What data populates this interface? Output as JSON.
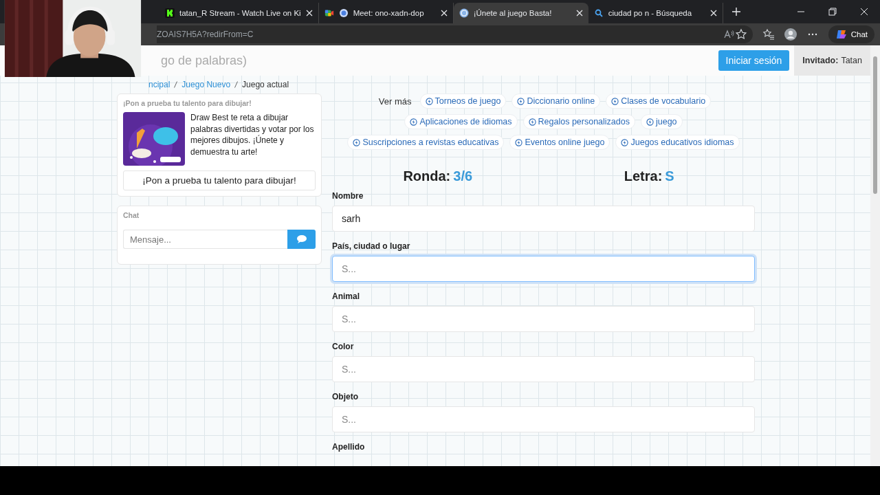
{
  "browser": {
    "tabs": [
      {
        "kind": "kick",
        "title": "tatan_R Stream - Watch Live on Ki",
        "selected": false
      },
      {
        "kind": "meet",
        "title": "Meet: ono-xadn-dop",
        "selected": false
      },
      {
        "kind": "game",
        "title": "¡Únete al juego Basta!",
        "selected": true
      },
      {
        "kind": "search",
        "title": "ciudad po n - Búsqueda",
        "selected": false
      }
    ],
    "address": "ZOAIS7H5A?redirFrom=C",
    "chat_button": "Chat"
  },
  "header": {
    "title": "go de palabras)",
    "login_button": "Iniciar sesión",
    "guest_label": "Invitado:",
    "guest_name": "Tatan"
  },
  "breadcrumb": [
    {
      "label": "ncipal",
      "link": true
    },
    {
      "label": "Juego Nuevo",
      "link": true
    },
    {
      "label": "Juego actual",
      "link": false
    }
  ],
  "promo": {
    "heading": "¡Pon a prueba tu talento para dibujar!",
    "description": "Draw Best te reta a dibujar palabras divertidas y votar por los mejores dibujos. ¡Únete y demuestra tu arte!",
    "button": "¡Pon a prueba tu talento para dibujar!"
  },
  "chat": {
    "heading": "Chat",
    "placeholder": "Mensaje..."
  },
  "more_label": "Ver más",
  "link_rows": [
    [
      "Torneos de juego",
      "Diccionario online",
      "Clases de vocabulario"
    ],
    [
      "Aplicaciones de idiomas",
      "Regalos personalizados",
      "juego"
    ],
    [
      "Suscripciones a revistas educativas",
      "Eventos online juego",
      "Juegos educativos idiomas"
    ]
  ],
  "round": {
    "label": "Ronda:",
    "value": "3/6"
  },
  "letter": {
    "label": "Letra:",
    "value": "S"
  },
  "fields": [
    {
      "label": "Nombre",
      "value": "sarh",
      "focused": false
    },
    {
      "label": "País, ciudad o lugar",
      "placeholder": "S...",
      "focused": true
    },
    {
      "label": "Animal",
      "placeholder": "S...",
      "focused": false
    },
    {
      "label": "Color",
      "placeholder": "S...",
      "focused": false
    },
    {
      "label": "Objeto",
      "placeholder": "S...",
      "focused": false
    },
    {
      "label": "Apellido",
      "kind": "label_only"
    }
  ]
}
